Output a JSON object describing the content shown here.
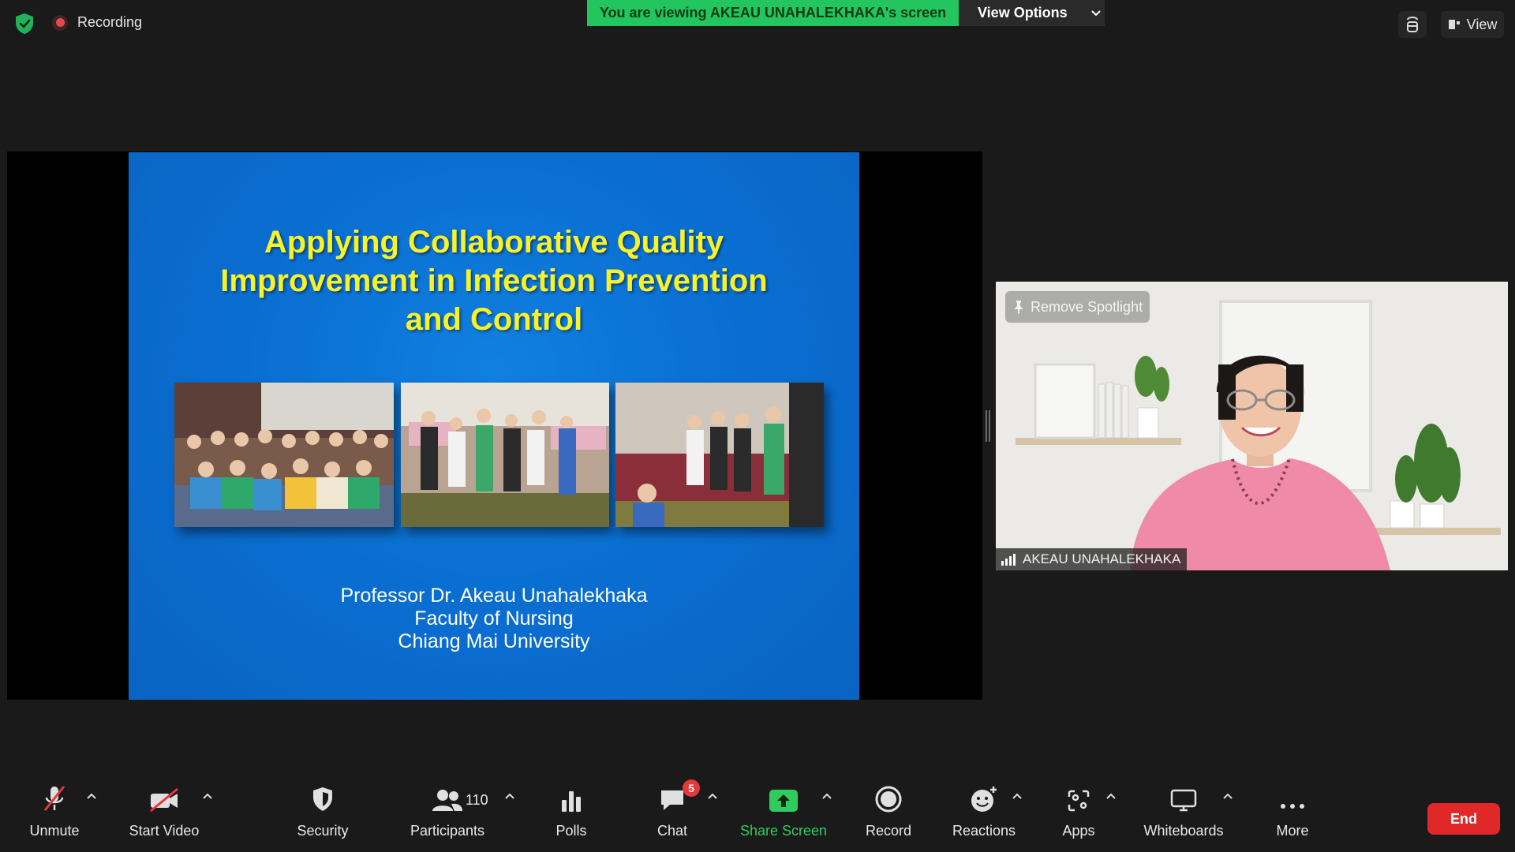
{
  "top_bar": {
    "recording_label": "Recording",
    "viewing_banner": "You are viewing AKEAU UNAHALEKHAKA's screen",
    "view_options_label": "View Options",
    "view_label": "View"
  },
  "slide": {
    "title_lines": [
      "Applying Collaborative Quality",
      "Improvement in Infection Prevention",
      "and Control"
    ],
    "author_lines": [
      "Professor Dr. Akeau Unahalekhaka",
      "Faculty of Nursing",
      "Chiang Mai University"
    ]
  },
  "video": {
    "spotlight_label": "Remove Spotlight",
    "participant_name": "AKEAU UNAHALEKHAKA"
  },
  "toolbar": {
    "unmute": "Unmute",
    "start_video": "Start Video",
    "security": "Security",
    "participants": "Participants",
    "participants_count": "110",
    "polls": "Polls",
    "chat": "Chat",
    "chat_badge": "5",
    "share_screen": "Share Screen",
    "record": "Record",
    "reactions": "Reactions",
    "apps": "Apps",
    "whiteboards": "Whiteboards",
    "more": "More",
    "end": "End"
  },
  "colors": {
    "background": "#1a1a1a",
    "banner_green": "#22c55e",
    "share_green": "#2ecc5f",
    "slide_blue": "#0a6fd2",
    "slide_title_yellow": "#f7f22a",
    "end_red": "#e02828",
    "badge_red": "#e5383b"
  },
  "icons": {
    "security_status": "shield-check-icon",
    "recording": "record-dot-icon",
    "view_options_chevron": "chevron-down-icon",
    "top_right_1": "immersive-icon",
    "top_right_view": "view-layout-icon",
    "spotlight": "pin-icon",
    "signal": "signal-bars-icon"
  }
}
